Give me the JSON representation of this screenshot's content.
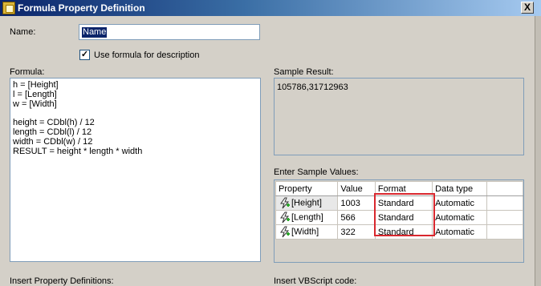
{
  "window": {
    "title": "Formula Property Definition",
    "close_label": "X"
  },
  "name": {
    "label": "Name:",
    "value": "Name"
  },
  "use_formula": {
    "label": "Use formula for description",
    "checked": true
  },
  "formula": {
    "label": "Formula:",
    "lines": [
      "h = [Height]",
      "l = [Length]",
      "w = [Width]",
      "",
      "height = CDbl(h) / 12",
      "length = CDbl(l) / 12",
      "width = CDbl(w) / 12",
      "RESULT = height * length * width"
    ]
  },
  "sample_result": {
    "label": "Sample Result:",
    "value": "105786,31712963"
  },
  "sample_values": {
    "label": "Enter Sample Values:",
    "columns": [
      "Property",
      "Value",
      "Format",
      "Data type"
    ],
    "rows": [
      {
        "property": "[Height]",
        "value": "1003",
        "format": "Standard",
        "data_type": "Automatic"
      },
      {
        "property": "[Length]",
        "value": "566",
        "format": "Standard",
        "data_type": "Automatic"
      },
      {
        "property": "[Width]",
        "value": "322",
        "format": "Standard",
        "data_type": "Automatic"
      }
    ]
  },
  "insert_property_definitions": {
    "label": "Insert Property Definitions:"
  },
  "insert_vbscript": {
    "label": "Insert VBScript code:"
  },
  "colors": {
    "title_gradient_start": "#0a246a",
    "highlight_box": "#d9272e",
    "dialog_bg": "#d4d0c8"
  }
}
